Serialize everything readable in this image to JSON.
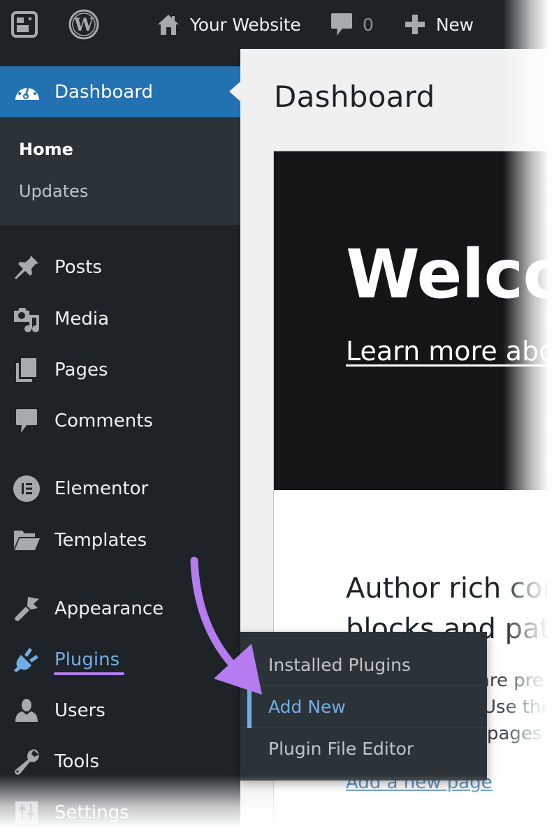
{
  "adminbar": {
    "site_editor_icon": "site-editor-icon",
    "wp_logo_icon": "wordpress-logo-icon",
    "site_name": "Your Website",
    "comments_count": "0",
    "new_label": "New"
  },
  "sidebar": {
    "dashboard": {
      "label": "Dashboard",
      "icon": "dashboard-gauge-icon",
      "submenu": [
        {
          "label": "Home",
          "current": true
        },
        {
          "label": "Updates",
          "current": false
        }
      ]
    },
    "items": [
      {
        "label": "Posts",
        "icon": "pushpin-icon"
      },
      {
        "label": "Media",
        "icon": "media-icon"
      },
      {
        "label": "Pages",
        "icon": "pages-icon"
      },
      {
        "label": "Comments",
        "icon": "comment-icon"
      },
      {
        "label": "Elementor",
        "icon": "elementor-icon"
      },
      {
        "label": "Templates",
        "icon": "folder-open-icon"
      },
      {
        "label": "Appearance",
        "icon": "paintbrush-icon"
      },
      {
        "label": "Plugins",
        "icon": "plugin-icon",
        "active": true
      },
      {
        "label": "Users",
        "icon": "user-icon"
      },
      {
        "label": "Tools",
        "icon": "wrench-icon"
      },
      {
        "label": "Settings",
        "icon": "settings-sliders-icon"
      }
    ]
  },
  "plugins_flyout": {
    "items": [
      {
        "label": "Installed Plugins",
        "current": false
      },
      {
        "label": "Add New",
        "current": true
      },
      {
        "label": "Plugin File Editor",
        "current": false
      }
    ]
  },
  "main": {
    "page_title": "Dashboard",
    "welcome": {
      "title": "Welco",
      "learn_more": "Learn more abo",
      "author_heading_line1": "Author rich con",
      "author_heading_line2": "blocks and patt",
      "body_line1": "are pre",
      "body_line2": "Use the",
      "body_line3": "pages i",
      "add_page_link": "Add a new page"
    }
  },
  "colors": {
    "adminbar_bg": "#1d2327",
    "sidebar_bg": "#1d2327",
    "submenu_bg": "#2c3338",
    "accent_blue": "#2271b1",
    "active_link": "#72aee6",
    "annotation_purple": "#b57cf0"
  }
}
